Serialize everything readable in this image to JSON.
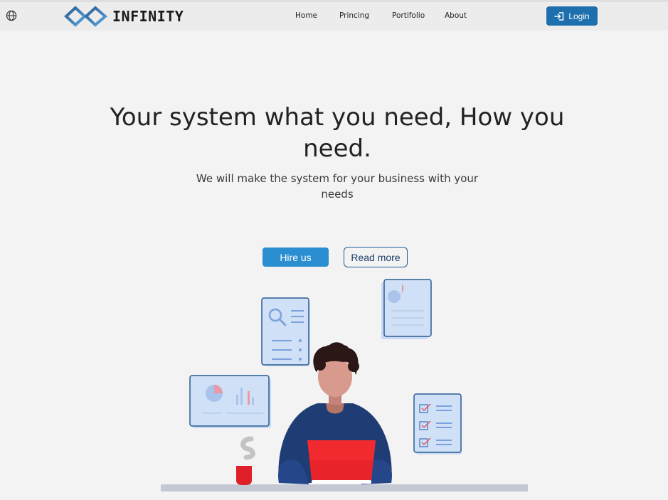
{
  "brand": {
    "name": "INFINITY",
    "icon": "infinity-logo"
  },
  "nav": {
    "globe_icon": "globe-icon",
    "links": [
      {
        "label": "Home"
      },
      {
        "label": "Princing"
      },
      {
        "label": "Portifolio"
      },
      {
        "label": "About"
      }
    ],
    "login_label": "Login",
    "login_icon": "sign-in-icon"
  },
  "hero": {
    "title": "Your system what you need, How you need.",
    "subtitle": "We will make the system for your business with your needs",
    "hire_label": "Hire us",
    "read_more_label": "Read more"
  },
  "colors": {
    "accent": "#2a8ed0",
    "login": "#1d6fad",
    "background": "#f3f3f4",
    "laptop": "#e8242a",
    "sweater": "#1f3d74"
  }
}
